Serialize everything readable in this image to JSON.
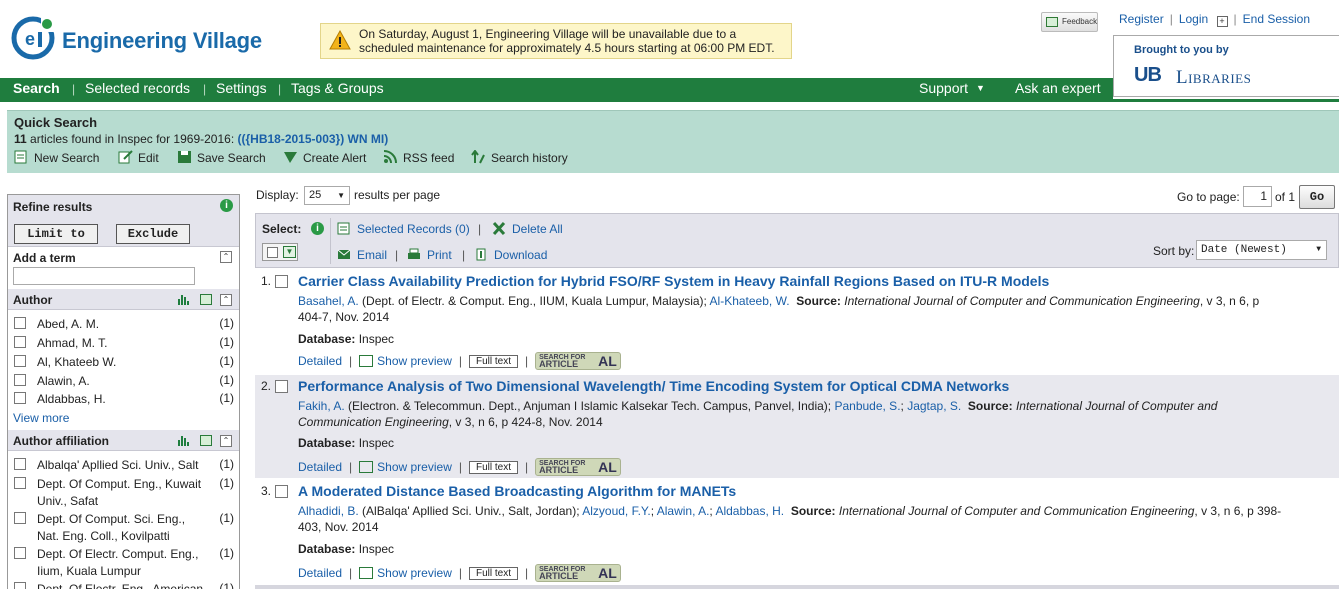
{
  "app": {
    "name": "Engineering Village",
    "notice": "On Saturday, August 1, Engineering Village will be unavailable due to a scheduled maintenance for approximately 4.5 hours starting at 06:00 PM EDT.",
    "feedback": "Feedback",
    "register": "Register",
    "login": "Login",
    "end_session": "End Session",
    "brought_by": "Brought to you by",
    "ub": "UB",
    "libraries": "Libraries"
  },
  "nav": {
    "items": [
      "Search",
      "Selected records",
      "Settings",
      "Tags & Groups"
    ],
    "support": "Support",
    "ask_expert": "Ask an expert"
  },
  "quick_search": {
    "title": "Quick Search",
    "count": "11",
    "desc_mid": " articles found in Inspec for 1969-2016: ",
    "query": "(({HB18-2015-003}) WN MI)",
    "actions": [
      "New Search",
      "Edit",
      "Save Search",
      "Create Alert",
      "RSS feed",
      "Search history"
    ]
  },
  "refine": {
    "title": "Refine results",
    "limit": "Limit to",
    "exclude": "Exclude",
    "add_term": "Add a term",
    "author_title": "Author",
    "authors": [
      {
        "name": "Abed, A. M.",
        "count": "(1)"
      },
      {
        "name": "Ahmad, M. T.",
        "count": "(1)"
      },
      {
        "name": "Al, Khateeb W.",
        "count": "(1)"
      },
      {
        "name": "Alawin, A.",
        "count": "(1)"
      },
      {
        "name": "Aldabbas, H.",
        "count": "(1)"
      }
    ],
    "view_more": "View more",
    "affil_title": "Author affiliation",
    "affiliations": [
      {
        "name": "Albalqa' Apllied Sci. Univ., Salt",
        "count": "(1)"
      },
      {
        "name": "Dept. Of Comput. Eng., Kuwait Univ., Safat",
        "count": "(1)"
      },
      {
        "name": "Dept. Of Comput. Sci. Eng., Nat. Eng. Coll., Kovilpatti",
        "count": "(1)"
      },
      {
        "name": "Dept. Of Electr. Comput. Eng., Iium, Kuala Lumpur",
        "count": "(1)"
      },
      {
        "name": "Dept. Of Electr. Eng., American",
        "count": "(1)"
      }
    ]
  },
  "results_bar": {
    "display_label": "Display:",
    "per_page": "25",
    "per_page_suffix": "results per page",
    "goto_label": "Go to page:",
    "page": "1",
    "of_pages": "of 1",
    "go": "Go",
    "select_label": "Select:",
    "selected_records": "Selected Records (0)",
    "delete_all": "Delete All",
    "email": "Email",
    "print": "Print",
    "download": "Download",
    "sort_label": "Sort by:",
    "sort_value": "Date (Newest)"
  },
  "results": [
    {
      "num": "1.",
      "title": "Carrier Class Availability Prediction for Hybrid FSO/RF System in Heavy Rainfall Regions Based on ITU-R Models",
      "author1": "Basahel, A.",
      "affil1": " (Dept. of Electr. & Comput. Eng., IIUM, Kuala Lumpur, Malaysia); ",
      "author2": "Al-Khateeb, W.",
      "source_label": "Source:",
      "journal": "International Journal of Computer and Communication Engineering",
      "pages": ", v 3, n 6, p 404-7, Nov. 2014",
      "database_label": "Database:",
      "database": "Inspec"
    },
    {
      "num": "2.",
      "title": "Performance Analysis of Two Dimensional Wavelength/ Time Encoding System for Optical CDMA Networks",
      "author1": "Fakih, A.",
      "affil1": " (Electron. & Telecommun. Dept., Anjuman I Islamic Kalsekar Tech. Campus, Panvel, India); ",
      "author2": "Panbude, S.",
      "author3": "Jagtap, S.",
      "source_label": "Source:",
      "journal": "International Journal of Computer and Communication Engineering",
      "pages": ", v 3, n 6, p 424-8, Nov. 2014",
      "database_label": "Database:",
      "database": "Inspec"
    },
    {
      "num": "3.",
      "title": "A Moderated Distance Based Broadcasting Algorithm for MANETs",
      "author1": "Alhadidi, B.",
      "affil1": " (AlBalqa' Apllied Sci. Univ., Salt, Jordan); ",
      "author2": "Alzyoud, F.Y.",
      "author3": "Alawin, A.",
      "author4": "Aldabbas, H.",
      "source_label": "Source:",
      "journal": "International Journal of Computer and Communication Engineering",
      "pages": ", v 3, n 6, p 398-403, Nov. 2014",
      "database_label": "Database:",
      "database": "Inspec"
    }
  ],
  "result_actions": {
    "detailed": "Detailed",
    "preview": "Show preview",
    "full_text": "Full text",
    "search_for": "SEARCH FOR",
    "article": "ARTICLE",
    "al": "AL"
  },
  "colors": {
    "nav_green": "#1f7d3e",
    "link_blue": "#1a5fa8",
    "search_bar": "#b7dcd0"
  }
}
